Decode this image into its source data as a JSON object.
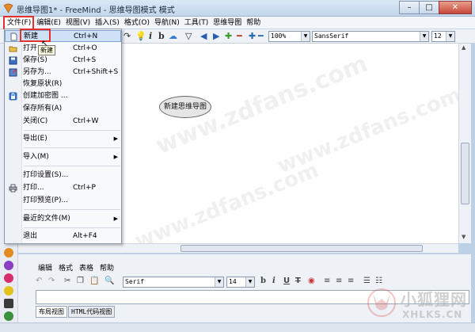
{
  "window": {
    "title": "思维导图1* - FreeMind - 思维导图模式 模式",
    "minimize": "–",
    "maximize": "□",
    "close": "✕"
  },
  "menubar": [
    "文件(F)",
    "编辑(E)",
    "视图(V)",
    "插入(S)",
    "格式(O)",
    "导航(N)",
    "工具(T)",
    "思维导图",
    "帮助"
  ],
  "toolbar": {
    "zoom": "100%",
    "font": "SansSerif",
    "font_size": "12"
  },
  "file_menu": {
    "items": [
      {
        "label": "新建",
        "shortcut": "Ctrl+N",
        "icon": "new-document-icon"
      },
      {
        "label": "打开",
        "shortcut": "Ctrl+O",
        "icon": "open-folder-icon"
      },
      {
        "label": "保存(S)",
        "shortcut": "Ctrl+S",
        "icon": "save-icon"
      },
      {
        "label": "另存为...",
        "shortcut": "Ctrl+Shift+S",
        "icon": "save-as-icon"
      },
      {
        "label": "恢复原状(R)",
        "shortcut": "",
        "icon": ""
      },
      {
        "label": "创建加密图 ...",
        "shortcut": "",
        "icon": "lock-icon"
      },
      {
        "label": "保存所有(A)",
        "shortcut": "",
        "icon": ""
      },
      {
        "label": "关闭(C)",
        "shortcut": "Ctrl+W",
        "icon": ""
      },
      {
        "label": "导出(E)",
        "shortcut": "",
        "submenu": true
      },
      {
        "label": "导入(M)",
        "shortcut": "",
        "submenu": true
      },
      {
        "label": "打印设置(S)...",
        "shortcut": "",
        "icon": ""
      },
      {
        "label": "打印...",
        "shortcut": "Ctrl+P",
        "icon": "printer-icon"
      },
      {
        "label": "打印预览(P)...",
        "shortcut": "",
        "icon": ""
      },
      {
        "label": "最近的文件(M)",
        "shortcut": "",
        "submenu": true
      },
      {
        "label": "退出",
        "shortcut": "Alt+F4",
        "icon": ""
      }
    ],
    "tooltip": "新建"
  },
  "mindmap": {
    "root_node": "新建思维导图"
  },
  "notes_editor": {
    "menu": [
      "编辑",
      "格式",
      "表格",
      "帮助"
    ],
    "font": "Serif",
    "font_size": "14",
    "tabs": [
      "布局视图",
      "HTML代码视图"
    ]
  },
  "watermarks": [
    "www.zdfans.com",
    "www.zdfans.com",
    "www.zdfans.com"
  ],
  "brand": {
    "name": "小狐狸网",
    "domain": "XHLKS.CN"
  },
  "colors": {
    "highlight_box": "#e3312c",
    "menu_highlight": "#cfe1f7"
  }
}
